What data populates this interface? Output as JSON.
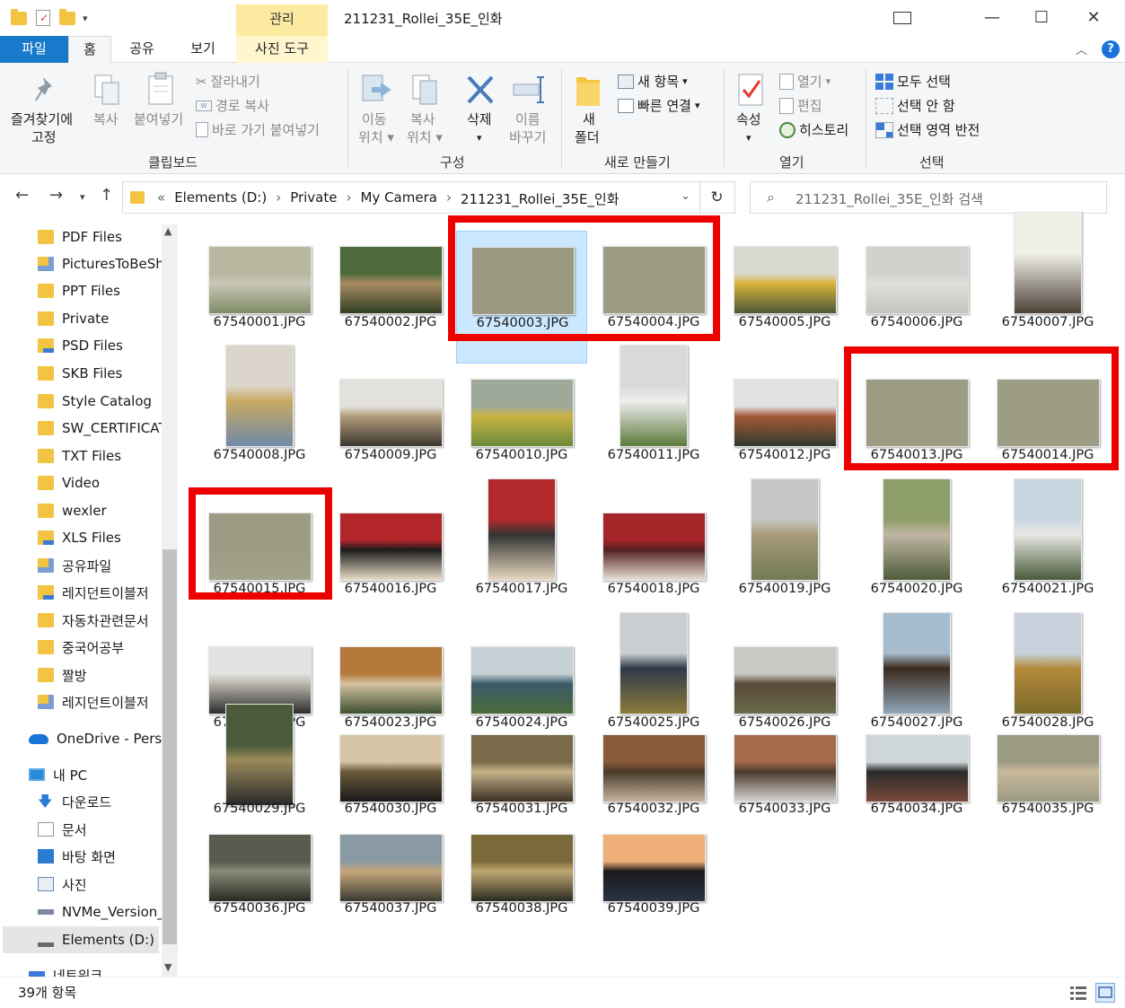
{
  "window": {
    "title": "211231_Rollei_35E_인화",
    "context_tab": "관리",
    "controls": {
      "minimize": "—",
      "maximize": "☐",
      "close": "✕"
    }
  },
  "ribbon_tabs": {
    "file": "파일",
    "home": "홈",
    "share": "공유",
    "view": "보기",
    "picture_tools": "사진 도구"
  },
  "ribbon": {
    "clipboard": {
      "label": "클립보드",
      "pin": "즐겨찾기에",
      "pin2": "고정",
      "copy": "복사",
      "paste": "붙여넣기",
      "cut": "잘라내기",
      "copy_path": "경로 복사",
      "paste_shortcut": "바로 가기 붙여넣기"
    },
    "organize": {
      "label": "구성",
      "move_to": "이동",
      "move_to2": "위치",
      "copy_to": "복사",
      "copy_to2": "위치",
      "delete": "삭제",
      "rename": "이름",
      "rename2": "바꾸기"
    },
    "new": {
      "label": "새로 만들기",
      "new_folder": "새",
      "new_folder2": "폴더",
      "new_item": "새 항목",
      "easy_access": "빠른 연결"
    },
    "open": {
      "label": "열기",
      "properties": "속성",
      "open": "열기",
      "edit": "편집",
      "history": "히스토리"
    },
    "select": {
      "label": "선택",
      "select_all": "모두 선택",
      "select_none": "선택 안 함",
      "invert": "선택 영역 반전"
    }
  },
  "address": {
    "crumbs": [
      "Elements (D:)",
      "Private",
      "My Camera",
      "211231_Rollei_35E_인화"
    ],
    "search_placeholder": "211231_Rollei_35E_인화 검색",
    "overflow": "«"
  },
  "nav": [
    {
      "label": "PDF Files",
      "icon": "folder-icon"
    },
    {
      "label": "PicturesToBeSha",
      "icon": "shared-folder-icon"
    },
    {
      "label": "PPT Files",
      "icon": "folder-icon"
    },
    {
      "label": "Private",
      "icon": "folder-icon"
    },
    {
      "label": "PSD Files",
      "icon": "folder-sync-icon"
    },
    {
      "label": "SKB Files",
      "icon": "folder-icon"
    },
    {
      "label": "Style Catalog",
      "icon": "folder-icon"
    },
    {
      "label": "SW_CERTIFICAT",
      "icon": "folder-icon"
    },
    {
      "label": "TXT Files",
      "icon": "folder-icon"
    },
    {
      "label": "Video",
      "icon": "folder-icon"
    },
    {
      "label": "wexler",
      "icon": "folder-icon"
    },
    {
      "label": "XLS Files",
      "icon": "folder-sync-icon"
    },
    {
      "label": "공유파일",
      "icon": "shared-folder-icon"
    },
    {
      "label": "레지던트이블저",
      "icon": "folder-sync-icon"
    },
    {
      "label": "자동차관련문서",
      "icon": "folder-icon"
    },
    {
      "label": "중국어공부",
      "icon": "folder-icon"
    },
    {
      "label": "짤방",
      "icon": "folder-icon"
    },
    {
      "label": "레지던트이블저",
      "icon": "shared-folder-icon"
    },
    {
      "label": "OneDrive - Perso",
      "icon": "onedrive-icon"
    },
    {
      "label": "내 PC",
      "icon": "pc-icon"
    },
    {
      "label": "다운로드",
      "icon": "download-icon"
    },
    {
      "label": "문서",
      "icon": "documents-icon"
    },
    {
      "label": "바탕 화면",
      "icon": "desktop-icon"
    },
    {
      "label": "사진",
      "icon": "pictures-icon"
    },
    {
      "label": "NVMe_Version_",
      "icon": "network-drive-icon"
    },
    {
      "label": "Elements (D:)",
      "icon": "drive-icon"
    },
    {
      "label": "네트워크",
      "icon": "network-icon"
    }
  ],
  "files": [
    {
      "name": "67540001.JPG",
      "colors": [
        "#b9b7a0",
        "#7f8b66",
        "#c9c7b6"
      ]
    },
    {
      "name": "67540002.JPG",
      "colors": [
        "#4d6a3a",
        "#2f3e24",
        "#a88c62"
      ]
    },
    {
      "name": "67540003.JPG",
      "colors": [
        "#9a9a82",
        "#9a9a82",
        "#9a9a82"
      ]
    },
    {
      "name": "67540004.JPG",
      "colors": [
        "#9b9b84",
        "#9b9b84",
        "#9b9b84"
      ]
    },
    {
      "name": "67540005.JPG",
      "colors": [
        "#d9d8ce",
        "#4c5737",
        "#d8b33a"
      ]
    },
    {
      "name": "67540006.JPG",
      "colors": [
        "#d1d2cd",
        "#c2c4be",
        "#e0e0da"
      ]
    },
    {
      "name": "67540007.JPG",
      "colors": [
        "#f0efe8",
        "#4d4137",
        "#c8c5bd"
      ]
    },
    {
      "name": "67540008.JPG",
      "colors": [
        "#dcd5cb",
        "#6f8aa8",
        "#c8aa62"
      ]
    },
    {
      "name": "67540009.JPG",
      "colors": [
        "#e3e1dc",
        "#3a3530",
        "#b39d7a"
      ]
    },
    {
      "name": "67540010.JPG",
      "colors": [
        "#9ea99a",
        "#6b8a3a",
        "#c9b443"
      ]
    },
    {
      "name": "67540011.JPG",
      "colors": [
        "#d8dad7",
        "#5d7a3c",
        "#eeeeee"
      ]
    },
    {
      "name": "67540012.JPG",
      "colors": [
        "#dfe2e1",
        "#2f3a2a",
        "#a55a3a"
      ]
    },
    {
      "name": "67540013.JPG",
      "colors": [
        "#9c9b84",
        "#9c9b84",
        "#9c9b84"
      ]
    },
    {
      "name": "67540014.JPG",
      "colors": [
        "#9d9c85",
        "#9d9c85",
        "#9d9c85"
      ]
    },
    {
      "name": "67540015.JPG",
      "colors": [
        "#9c9b84",
        "#a3a28b",
        "#9c9b84"
      ]
    },
    {
      "name": "67540016.JPG",
      "colors": [
        "#b3262a",
        "#e8dcc6",
        "#1c1c1c"
      ]
    },
    {
      "name": "67540017.JPG",
      "colors": [
        "#b22a2c",
        "#e6d8c0",
        "#333333"
      ]
    },
    {
      "name": "67540018.JPG",
      "colors": [
        "#a52528",
        "#e7e0d4",
        "#552222"
      ]
    },
    {
      "name": "67540019.JPG",
      "colors": [
        "#c5c8c4",
        "#6f7c52",
        "#a99a7a"
      ]
    },
    {
      "name": "67540020.JPG",
      "colors": [
        "#8e9e6a",
        "#4f5c3a",
        "#bfb6a3"
      ]
    },
    {
      "name": "67540021.JPG",
      "colors": [
        "#c9d6e0",
        "#4a5a3a",
        "#e7e7e2"
      ]
    },
    {
      "name": "67540022.JPG",
      "colors": [
        "#e1e3e0",
        "#2d2d2d",
        "#b9b6ad"
      ]
    },
    {
      "name": "67540023.JPG",
      "colors": [
        "#b4793a",
        "#3c5030",
        "#d4c2a0"
      ]
    },
    {
      "name": "67540024.JPG",
      "colors": [
        "#c6d1d6",
        "#4a6a3a",
        "#3a5a6a"
      ]
    },
    {
      "name": "67540025.JPG",
      "colors": [
        "#c9cfd0",
        "#8a7a3a",
        "#2f3a4a"
      ]
    },
    {
      "name": "67540026.JPG",
      "colors": [
        "#c7c9c2",
        "#6a6a4a",
        "#5a4a3a"
      ]
    },
    {
      "name": "67540027.JPG",
      "colors": [
        "#a7bccc",
        "#90a6b8",
        "#3a2a1e"
      ]
    },
    {
      "name": "67540028.JPG",
      "colors": [
        "#c8d2dc",
        "#7a6a2a",
        "#b48a3a"
      ]
    },
    {
      "name": "67540029.JPG",
      "colors": [
        "#4a5a3a",
        "#2a2a2a",
        "#9a8a5a"
      ]
    },
    {
      "name": "67540030.JPG",
      "colors": [
        "#d6c6a6",
        "#1a1a1a",
        "#6a5a3a"
      ]
    },
    {
      "name": "67540031.JPG",
      "colors": [
        "#7a6a4a",
        "#3a2e22",
        "#c6b48a"
      ]
    },
    {
      "name": "67540032.JPG",
      "colors": [
        "#8a5a3a",
        "#c4b4a0",
        "#4a3a2a"
      ]
    },
    {
      "name": "67540033.JPG",
      "colors": [
        "#a46a4a",
        "#d6d6d6",
        "#4a3a2a"
      ]
    },
    {
      "name": "67540034.JPG",
      "colors": [
        "#cfd6da",
        "#7a4a3a",
        "#2a2a2a"
      ]
    },
    {
      "name": "67540035.JPG",
      "colors": [
        "#9b9a83",
        "#9b9a83",
        "#c9b99a"
      ]
    },
    {
      "name": "67540036.JPG",
      "colors": [
        "#5a5a4e",
        "#2a2a24",
        "#8a8a78"
      ]
    },
    {
      "name": "67540037.JPG",
      "colors": [
        "#8a9aa4",
        "#3a3a32",
        "#c6a67a"
      ]
    },
    {
      "name": "67540038.JPG",
      "colors": [
        "#7a6a3a",
        "#2a2a22",
        "#c0a870"
      ]
    },
    {
      "name": "67540039.JPG",
      "colors": [
        "#f0b07a",
        "#2a3444",
        "#1a1a1a"
      ]
    }
  ],
  "status": {
    "count": "39개 항목"
  }
}
